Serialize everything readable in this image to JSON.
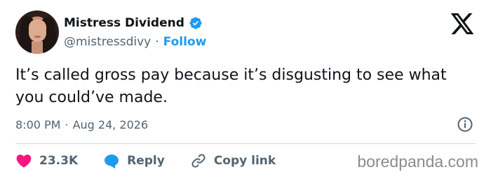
{
  "author": {
    "name": "Mistress Dividend",
    "handle": "@mistressdivy",
    "separator": "·",
    "follow_label": "Follow"
  },
  "tweet": {
    "text": "It’s called gross pay because it’s disgusting to see what you could’ve made.",
    "time": "8:00 PM",
    "date": "Aug 24, 2026",
    "separator": "·"
  },
  "actions": {
    "likes": "23.3K",
    "reply_label": "Reply",
    "copy_link_label": "Copy link"
  },
  "watermark": "boredpanda.com",
  "colors": {
    "verified": "#1d9bf0",
    "follow": "#1d9bf0",
    "heart": "#f91880",
    "reply_bubble": "#1d9bf0",
    "secondary_text": "#536471",
    "text": "#0f1419"
  },
  "icons": [
    "verified-badge-icon",
    "x-logo-icon",
    "info-icon",
    "heart-icon",
    "reply-icon",
    "link-icon"
  ]
}
